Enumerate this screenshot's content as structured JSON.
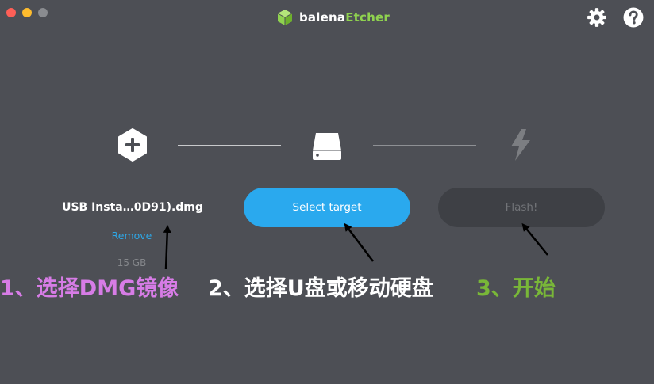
{
  "window": {
    "brand_primary": "balena",
    "brand_secondary": "Etcher"
  },
  "icons": {
    "settings": "gear-icon",
    "help": "help-icon",
    "step1": "plus-hexagon-icon",
    "step2": "drive-icon",
    "step3": "lightning-icon"
  },
  "image": {
    "filename": "USB Insta…0D91).dmg",
    "remove_label": "Remove",
    "size": "15 GB"
  },
  "target": {
    "button_label": "Select target"
  },
  "flash": {
    "button_label": "Flash!"
  },
  "annotations": {
    "step1": "1、选择DMG镜像",
    "step2": "2、选择U盘或移动硬盘",
    "step3": "3、开始"
  },
  "colors": {
    "background": "#4d4f55",
    "accent_blue": "#2aa9ee",
    "brand_green": "#8fd24f",
    "annotation_1": "#d77ce6",
    "annotation_2": "#ffffff",
    "annotation_3": "#79b738"
  }
}
